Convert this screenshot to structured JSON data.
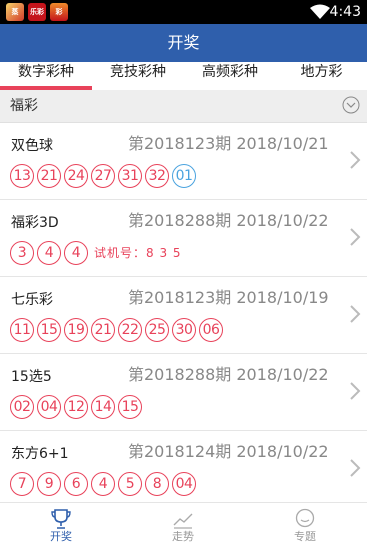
{
  "status_bar": {
    "time": "4:43",
    "apps": [
      "蒸",
      "乐彩",
      "彩"
    ]
  },
  "header": {
    "title": "开奖"
  },
  "tabs": [
    {
      "label": "数字彩种",
      "active": true
    },
    {
      "label": "竞技彩种",
      "active": false
    },
    {
      "label": "高频彩种",
      "active": false
    },
    {
      "label": "地方彩",
      "active": false
    }
  ],
  "section": {
    "title": "福彩"
  },
  "lotteries": [
    {
      "name": "双色球",
      "issue": "第2018123期 2018/10/21",
      "red_balls": [
        "13",
        "21",
        "24",
        "27",
        "31",
        "32"
      ],
      "blue_balls": [
        "01"
      ]
    },
    {
      "name": "福彩3D",
      "issue": "第2018288期 2018/10/22",
      "red_balls": [
        "3",
        "4",
        "4"
      ],
      "test_number": "试机号：8 3 5"
    },
    {
      "name": "七乐彩",
      "issue": "第2018123期 2018/10/19",
      "red_balls": [
        "11",
        "15",
        "19",
        "21",
        "22",
        "25",
        "30",
        "06"
      ]
    },
    {
      "name": "15选5",
      "issue": "第2018288期 2018/10/22",
      "red_balls": [
        "02",
        "04",
        "12",
        "14",
        "15"
      ]
    },
    {
      "name": "东方6+1",
      "issue": "第2018124期 2018/10/22",
      "red_balls": [
        "7",
        "9",
        "6",
        "4",
        "5",
        "8",
        "04"
      ]
    }
  ],
  "bottom_nav": [
    {
      "label": "开奖",
      "icon": "trophy-icon",
      "active": true
    },
    {
      "label": "走势",
      "icon": "trend-chart-icon",
      "active": false
    },
    {
      "label": "专题",
      "icon": "chat-bubble-icon",
      "active": false
    }
  ],
  "colors": {
    "brand": "#2f5fac",
    "red_ball": "#e8425a",
    "blue_ball": "#4aa3df"
  }
}
